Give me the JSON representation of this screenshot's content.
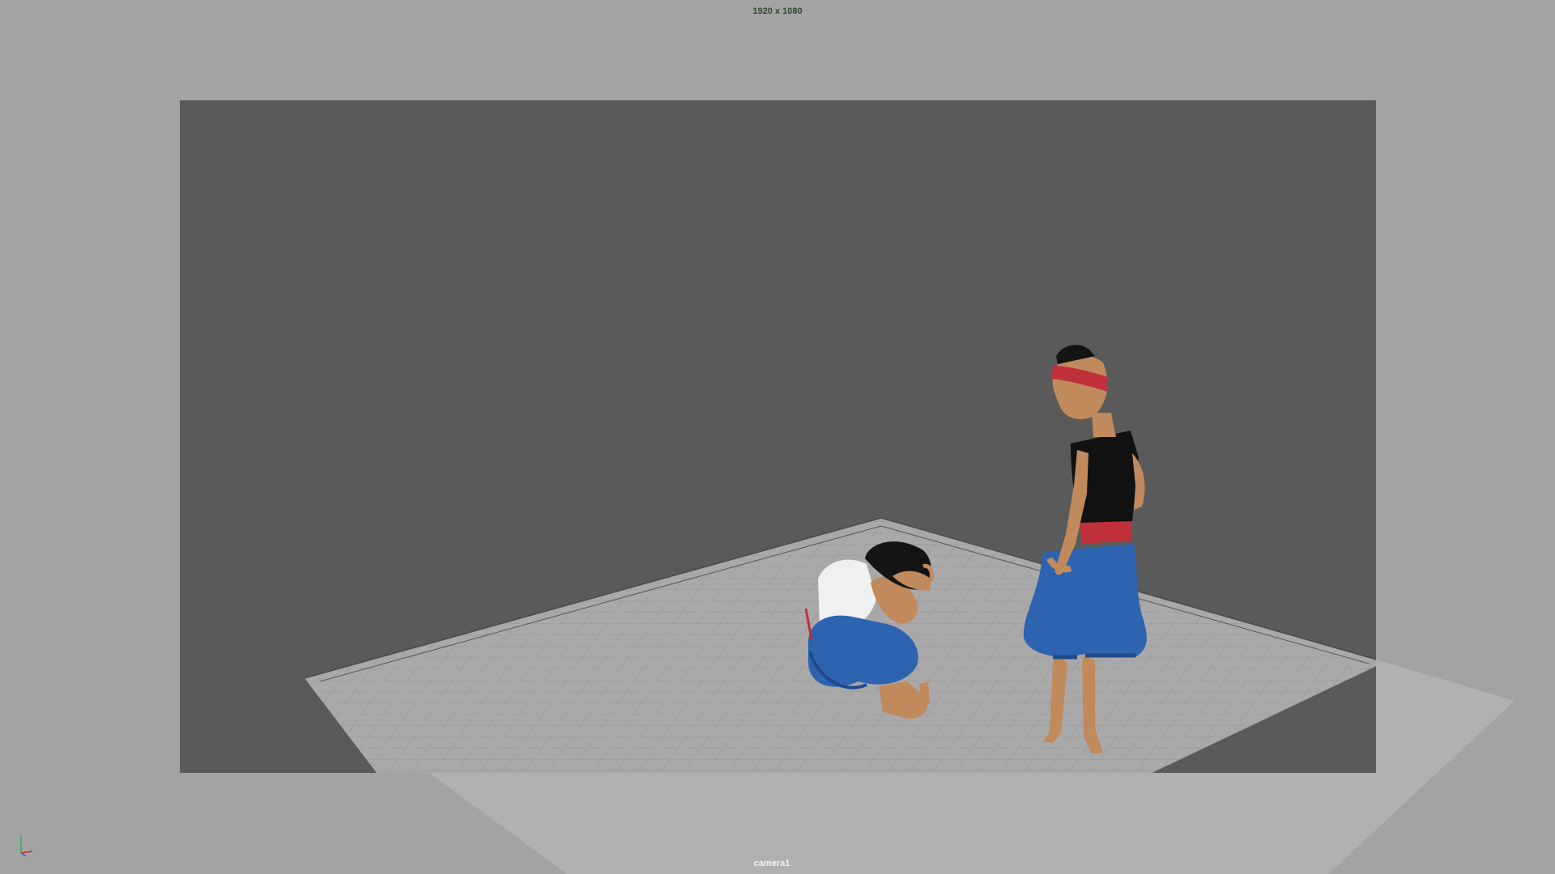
{
  "viewport": {
    "resolution_gate_label": "1920 x 1080",
    "camera_name": "camera1",
    "colors": {
      "outside_gate": "#a3a3a3",
      "background": "#5a5a5a",
      "grid_floor": "#a9a9a9",
      "grid_lines": "#8f8f8f",
      "character_skin": "#c08a5c",
      "pants": "#2e63b0",
      "shirt_standing": "#111111",
      "sash_headband": "#c0303a",
      "shirt_crouching": "#f0f0f0",
      "hair": "#141414"
    },
    "characters": [
      {
        "name": "crouching-character",
        "pose": "crouching, hands on head"
      },
      {
        "name": "standing-character",
        "pose": "standing, looking down"
      }
    ],
    "axis_gizmo_icon": "xyz-axis-icon"
  }
}
